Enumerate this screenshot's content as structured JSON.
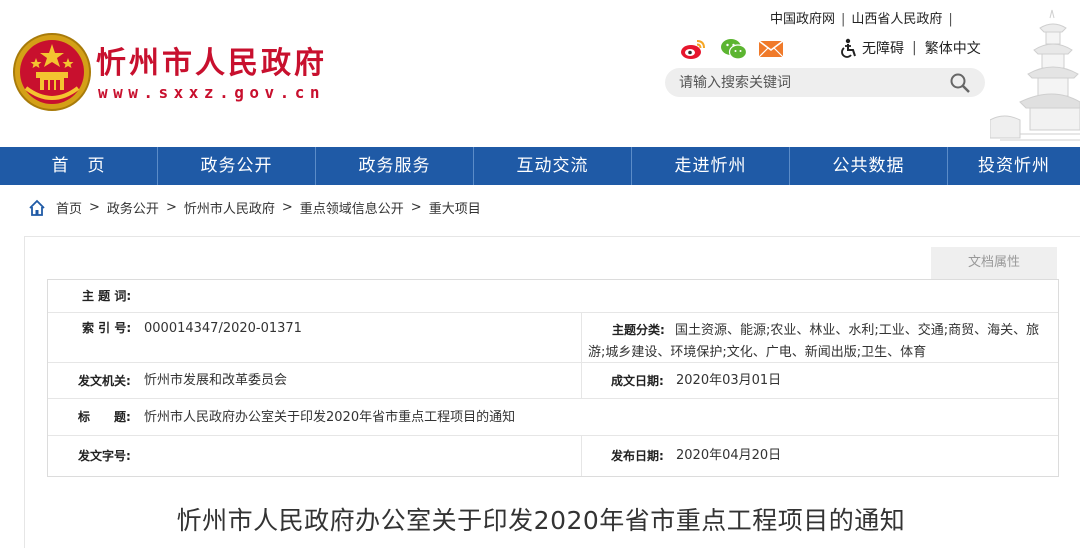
{
  "header": {
    "site_title": "忻州市人民政府",
    "site_url": "www.sxxz.gov.cn",
    "top_links": [
      "中国政府网",
      "山西省人民政府"
    ],
    "accessibility": "无障碍",
    "traditional": "繁体中文",
    "search_placeholder": "请输入搜索关键词",
    "icons": [
      "weibo-icon",
      "wechat-icon",
      "mail-icon",
      "accessibility-icon",
      "search-icon"
    ],
    "colors": {
      "brand_red": "#c8102e",
      "nav_blue": "#1f5aa6"
    }
  },
  "nav": {
    "items": [
      "首　页",
      "政务公开",
      "政务服务",
      "互动交流",
      "走进忻州",
      "公共数据",
      "投资忻州"
    ]
  },
  "breadcrumb": {
    "items": [
      "首页",
      "政务公开",
      "忻州市人民政府",
      "重点领域信息公开",
      "重大项目"
    ],
    "separator": ">"
  },
  "doc": {
    "attr_tab": "文档属性",
    "labels": {
      "subject": "主 题 词:",
      "index": "索 引 号:",
      "topic_category": "主题分类:",
      "issuer": "发文机关:",
      "created_date": "成文日期:",
      "title": "标　　题:",
      "doc_number": "发文字号:",
      "publish_date": "发布日期:"
    },
    "values": {
      "subject": "",
      "index": "000014347/2020-01371",
      "topic_category": "国土资源、能源;农业、林业、水利;工业、交通;商贸、海关、旅游;城乡建设、环境保护;文化、广电、新闻出版;卫生、体育",
      "issuer": "忻州市发展和改革委员会",
      "created_date": "2020年03月01日",
      "title": "忻州市人民政府办公室关于印发2020年省市重点工程项目的通知",
      "doc_number": "",
      "publish_date": "2020年04月20日"
    },
    "heading": "忻州市人民政府办公室关于印发2020年省市重点工程项目的通知"
  }
}
